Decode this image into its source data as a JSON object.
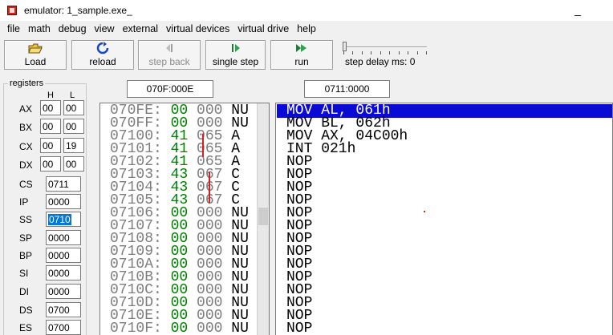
{
  "window": {
    "title": "emulator: 1_sample.exe_",
    "minimize_glyph": "_"
  },
  "menu": [
    "file",
    "math",
    "debug",
    "view",
    "external",
    "virtual devices",
    "virtual drive",
    "help"
  ],
  "toolbar": {
    "load": "Load",
    "reload": "reload",
    "step_back": "step back",
    "single_step": "single step",
    "run": "run",
    "step_delay_label": "step delay ms: 0"
  },
  "memory_address": "070F:000E",
  "disasm_address": "0711:0000",
  "registers": {
    "group_label": "registers",
    "h_header": "H",
    "l_header": "L",
    "AX": {
      "name": "AX",
      "h": "00",
      "l": "00"
    },
    "BX": {
      "name": "BX",
      "h": "00",
      "l": "00"
    },
    "CX": {
      "name": "CX",
      "h": "00",
      "l": "19"
    },
    "DX": {
      "name": "DX",
      "h": "00",
      "l": "00"
    },
    "CS": {
      "name": "CS",
      "value": "0711"
    },
    "IP": {
      "name": "IP",
      "value": "0000"
    },
    "SS": {
      "name": "SS",
      "value": "0710"
    },
    "SP": {
      "name": "SP",
      "value": "0000"
    },
    "BP": {
      "name": "BP",
      "value": "0000"
    },
    "SI": {
      "name": "SI",
      "value": "0000"
    },
    "DI": {
      "name": "DI",
      "value": "0000"
    },
    "DS": {
      "name": "DS",
      "value": "0700"
    },
    "ES": {
      "name": "ES",
      "value": "0700"
    }
  },
  "memory_rows": [
    {
      "addr": "070FE:",
      "hex": "00",
      "dec": "000",
      "chr": "NU"
    },
    {
      "addr": "070FF:",
      "hex": "00",
      "dec": "000",
      "chr": "NU"
    },
    {
      "addr": "07100:",
      "hex": "41",
      "dec": "065",
      "chr": "A"
    },
    {
      "addr": "07101:",
      "hex": "41",
      "dec": "065",
      "chr": "A"
    },
    {
      "addr": "07102:",
      "hex": "41",
      "dec": "065",
      "chr": "A"
    },
    {
      "addr": "07103:",
      "hex": "43",
      "dec": "067",
      "chr": "C"
    },
    {
      "addr": "07104:",
      "hex": "43",
      "dec": "067",
      "chr": "C"
    },
    {
      "addr": "07105:",
      "hex": "43",
      "dec": "067",
      "chr": "C"
    },
    {
      "addr": "07106:",
      "hex": "00",
      "dec": "000",
      "chr": "NU"
    },
    {
      "addr": "07107:",
      "hex": "00",
      "dec": "000",
      "chr": "NU"
    },
    {
      "addr": "07108:",
      "hex": "00",
      "dec": "000",
      "chr": "NU"
    },
    {
      "addr": "07109:",
      "hex": "00",
      "dec": "000",
      "chr": "NU"
    },
    {
      "addr": "0710A:",
      "hex": "00",
      "dec": "000",
      "chr": "NU"
    },
    {
      "addr": "0710B:",
      "hex": "00",
      "dec": "000",
      "chr": "NU"
    },
    {
      "addr": "0710C:",
      "hex": "00",
      "dec": "000",
      "chr": "NU"
    },
    {
      "addr": "0710D:",
      "hex": "00",
      "dec": "000",
      "chr": "NU"
    },
    {
      "addr": "0710E:",
      "hex": "00",
      "dec": "000",
      "chr": "NU"
    },
    {
      "addr": "0710F:",
      "hex": "00",
      "dec": "000",
      "chr": "NU"
    }
  ],
  "disasm_rows": [
    "MOV AL, 061h",
    "MOV BL, 062h",
    "MOV AX, 04C00h",
    "INT 021h",
    "NOP",
    "NOP",
    "NOP",
    "NOP",
    "NOP",
    "NOP",
    "NOP",
    "NOP",
    "NOP",
    "NOP",
    "NOP",
    "NOP",
    "NOP",
    "NOP"
  ],
  "colors": {
    "selection_blue": "#0a0ad6",
    "hex_green": "#008000",
    "addr_gray": "#7d7d7d",
    "annotation_red": "#d81e1e"
  }
}
